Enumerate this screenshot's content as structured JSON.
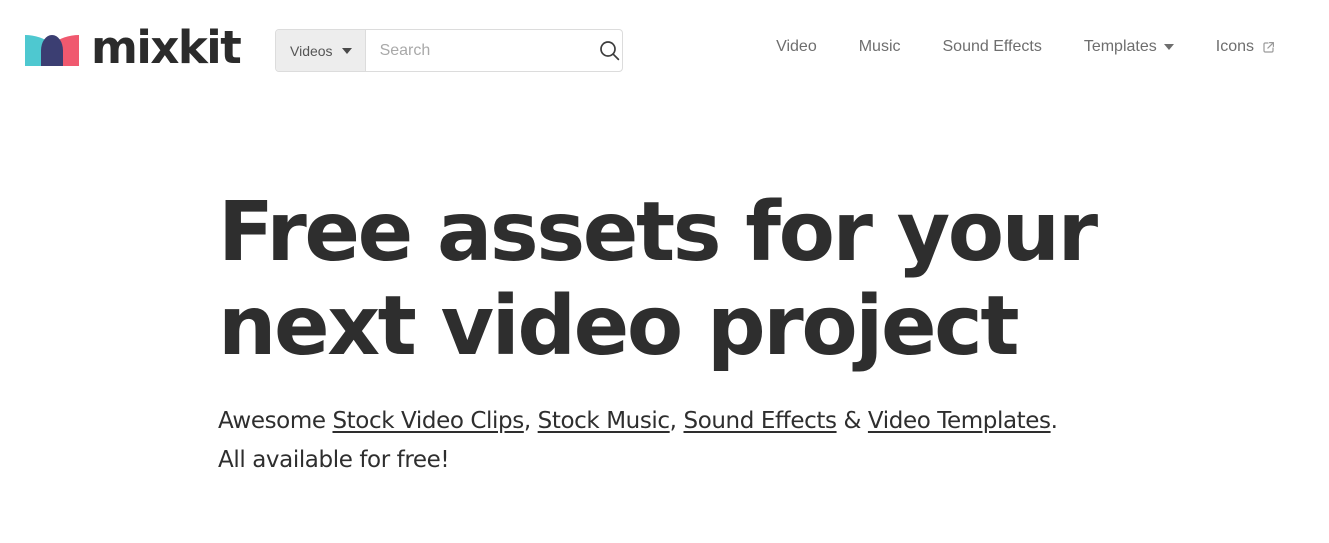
{
  "site": {
    "logo_text": "mixkit",
    "logo_colors": {
      "teal": "#4ec8d0",
      "pink": "#f0596f",
      "navy": "#3b3e72",
      "wordmark": "#2b2b2b"
    }
  },
  "search": {
    "scope_label": "Videos",
    "placeholder": "Search",
    "value": "",
    "submit_icon": "search-icon",
    "scope_icon": "chevron-down-icon"
  },
  "nav": {
    "items": [
      {
        "label": "Video",
        "icon": ""
      },
      {
        "label": "Music",
        "icon": ""
      },
      {
        "label": "Sound Effects",
        "icon": ""
      },
      {
        "label": "Templates",
        "icon": "chevron-down-icon"
      },
      {
        "label": "Icons",
        "icon": "external-link-icon"
      }
    ]
  },
  "hero": {
    "title_line_1": "Free assets for your",
    "title_line_2": "next video project",
    "subtitle": {
      "lead": "Awesome ",
      "link_1": "Stock Video Clips",
      "sep_1": ", ",
      "link_2": "Stock Music",
      "sep_2": ", ",
      "link_3": "Sound Effects",
      "sep_3": " & ",
      "link_4": "Video Templates",
      "tail": ".",
      "line_2": "All available for free!"
    }
  },
  "colors": {
    "background": "#ffffff",
    "heading": "#2e2e2e",
    "nav_text": "#6e6e6e",
    "placeholder": "#a9a9a9",
    "scope_bg": "#ededed",
    "border": "#dcdcdc"
  }
}
